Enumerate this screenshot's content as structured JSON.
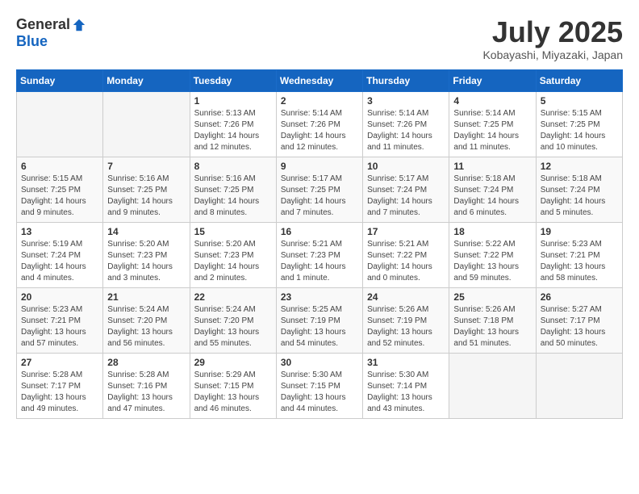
{
  "header": {
    "logo_general": "General",
    "logo_blue": "Blue",
    "month_title": "July 2025",
    "location": "Kobayashi, Miyazaki, Japan"
  },
  "weekdays": [
    "Sunday",
    "Monday",
    "Tuesday",
    "Wednesday",
    "Thursday",
    "Friday",
    "Saturday"
  ],
  "weeks": [
    [
      {
        "day": "",
        "info": ""
      },
      {
        "day": "",
        "info": ""
      },
      {
        "day": "1",
        "info": "Sunrise: 5:13 AM\nSunset: 7:26 PM\nDaylight: 14 hours and 12 minutes."
      },
      {
        "day": "2",
        "info": "Sunrise: 5:14 AM\nSunset: 7:26 PM\nDaylight: 14 hours and 12 minutes."
      },
      {
        "day": "3",
        "info": "Sunrise: 5:14 AM\nSunset: 7:26 PM\nDaylight: 14 hours and 11 minutes."
      },
      {
        "day": "4",
        "info": "Sunrise: 5:14 AM\nSunset: 7:25 PM\nDaylight: 14 hours and 11 minutes."
      },
      {
        "day": "5",
        "info": "Sunrise: 5:15 AM\nSunset: 7:25 PM\nDaylight: 14 hours and 10 minutes."
      }
    ],
    [
      {
        "day": "6",
        "info": "Sunrise: 5:15 AM\nSunset: 7:25 PM\nDaylight: 14 hours and 9 minutes."
      },
      {
        "day": "7",
        "info": "Sunrise: 5:16 AM\nSunset: 7:25 PM\nDaylight: 14 hours and 9 minutes."
      },
      {
        "day": "8",
        "info": "Sunrise: 5:16 AM\nSunset: 7:25 PM\nDaylight: 14 hours and 8 minutes."
      },
      {
        "day": "9",
        "info": "Sunrise: 5:17 AM\nSunset: 7:25 PM\nDaylight: 14 hours and 7 minutes."
      },
      {
        "day": "10",
        "info": "Sunrise: 5:17 AM\nSunset: 7:24 PM\nDaylight: 14 hours and 7 minutes."
      },
      {
        "day": "11",
        "info": "Sunrise: 5:18 AM\nSunset: 7:24 PM\nDaylight: 14 hours and 6 minutes."
      },
      {
        "day": "12",
        "info": "Sunrise: 5:18 AM\nSunset: 7:24 PM\nDaylight: 14 hours and 5 minutes."
      }
    ],
    [
      {
        "day": "13",
        "info": "Sunrise: 5:19 AM\nSunset: 7:24 PM\nDaylight: 14 hours and 4 minutes."
      },
      {
        "day": "14",
        "info": "Sunrise: 5:20 AM\nSunset: 7:23 PM\nDaylight: 14 hours and 3 minutes."
      },
      {
        "day": "15",
        "info": "Sunrise: 5:20 AM\nSunset: 7:23 PM\nDaylight: 14 hours and 2 minutes."
      },
      {
        "day": "16",
        "info": "Sunrise: 5:21 AM\nSunset: 7:23 PM\nDaylight: 14 hours and 1 minute."
      },
      {
        "day": "17",
        "info": "Sunrise: 5:21 AM\nSunset: 7:22 PM\nDaylight: 14 hours and 0 minutes."
      },
      {
        "day": "18",
        "info": "Sunrise: 5:22 AM\nSunset: 7:22 PM\nDaylight: 13 hours and 59 minutes."
      },
      {
        "day": "19",
        "info": "Sunrise: 5:23 AM\nSunset: 7:21 PM\nDaylight: 13 hours and 58 minutes."
      }
    ],
    [
      {
        "day": "20",
        "info": "Sunrise: 5:23 AM\nSunset: 7:21 PM\nDaylight: 13 hours and 57 minutes."
      },
      {
        "day": "21",
        "info": "Sunrise: 5:24 AM\nSunset: 7:20 PM\nDaylight: 13 hours and 56 minutes."
      },
      {
        "day": "22",
        "info": "Sunrise: 5:24 AM\nSunset: 7:20 PM\nDaylight: 13 hours and 55 minutes."
      },
      {
        "day": "23",
        "info": "Sunrise: 5:25 AM\nSunset: 7:19 PM\nDaylight: 13 hours and 54 minutes."
      },
      {
        "day": "24",
        "info": "Sunrise: 5:26 AM\nSunset: 7:19 PM\nDaylight: 13 hours and 52 minutes."
      },
      {
        "day": "25",
        "info": "Sunrise: 5:26 AM\nSunset: 7:18 PM\nDaylight: 13 hours and 51 minutes."
      },
      {
        "day": "26",
        "info": "Sunrise: 5:27 AM\nSunset: 7:17 PM\nDaylight: 13 hours and 50 minutes."
      }
    ],
    [
      {
        "day": "27",
        "info": "Sunrise: 5:28 AM\nSunset: 7:17 PM\nDaylight: 13 hours and 49 minutes."
      },
      {
        "day": "28",
        "info": "Sunrise: 5:28 AM\nSunset: 7:16 PM\nDaylight: 13 hours and 47 minutes."
      },
      {
        "day": "29",
        "info": "Sunrise: 5:29 AM\nSunset: 7:15 PM\nDaylight: 13 hours and 46 minutes."
      },
      {
        "day": "30",
        "info": "Sunrise: 5:30 AM\nSunset: 7:15 PM\nDaylight: 13 hours and 44 minutes."
      },
      {
        "day": "31",
        "info": "Sunrise: 5:30 AM\nSunset: 7:14 PM\nDaylight: 13 hours and 43 minutes."
      },
      {
        "day": "",
        "info": ""
      },
      {
        "day": "",
        "info": ""
      }
    ]
  ]
}
